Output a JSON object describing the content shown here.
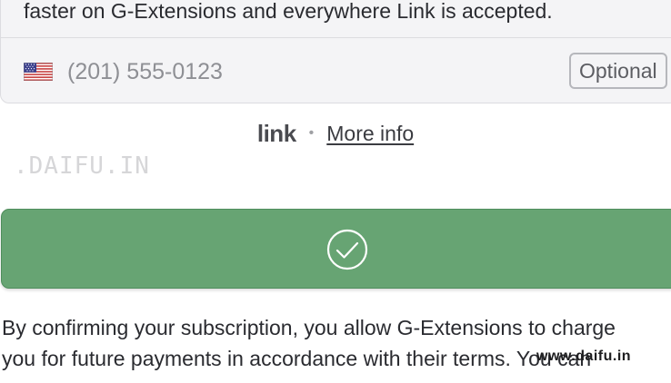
{
  "link_card": {
    "description": "faster on G-Extensions and everywhere Link is accepted.",
    "phone_placeholder": "(201) 555-0123",
    "optional_label": "Optional",
    "flag_icon": "us-flag-icon"
  },
  "link_footer": {
    "logo": "link",
    "separator": "•",
    "more_info": "More info"
  },
  "watermarks": {
    "top": ".DAIFU.IN",
    "bottom": "www.daifu.in"
  },
  "confirm_button": {
    "icon": "check-circle-icon",
    "color": "#67a473"
  },
  "disclaimer": {
    "line1": "By confirming your subscription, you allow G-Extensions to charge",
    "line2": "you for future payments in accordance with their terms. You can"
  }
}
